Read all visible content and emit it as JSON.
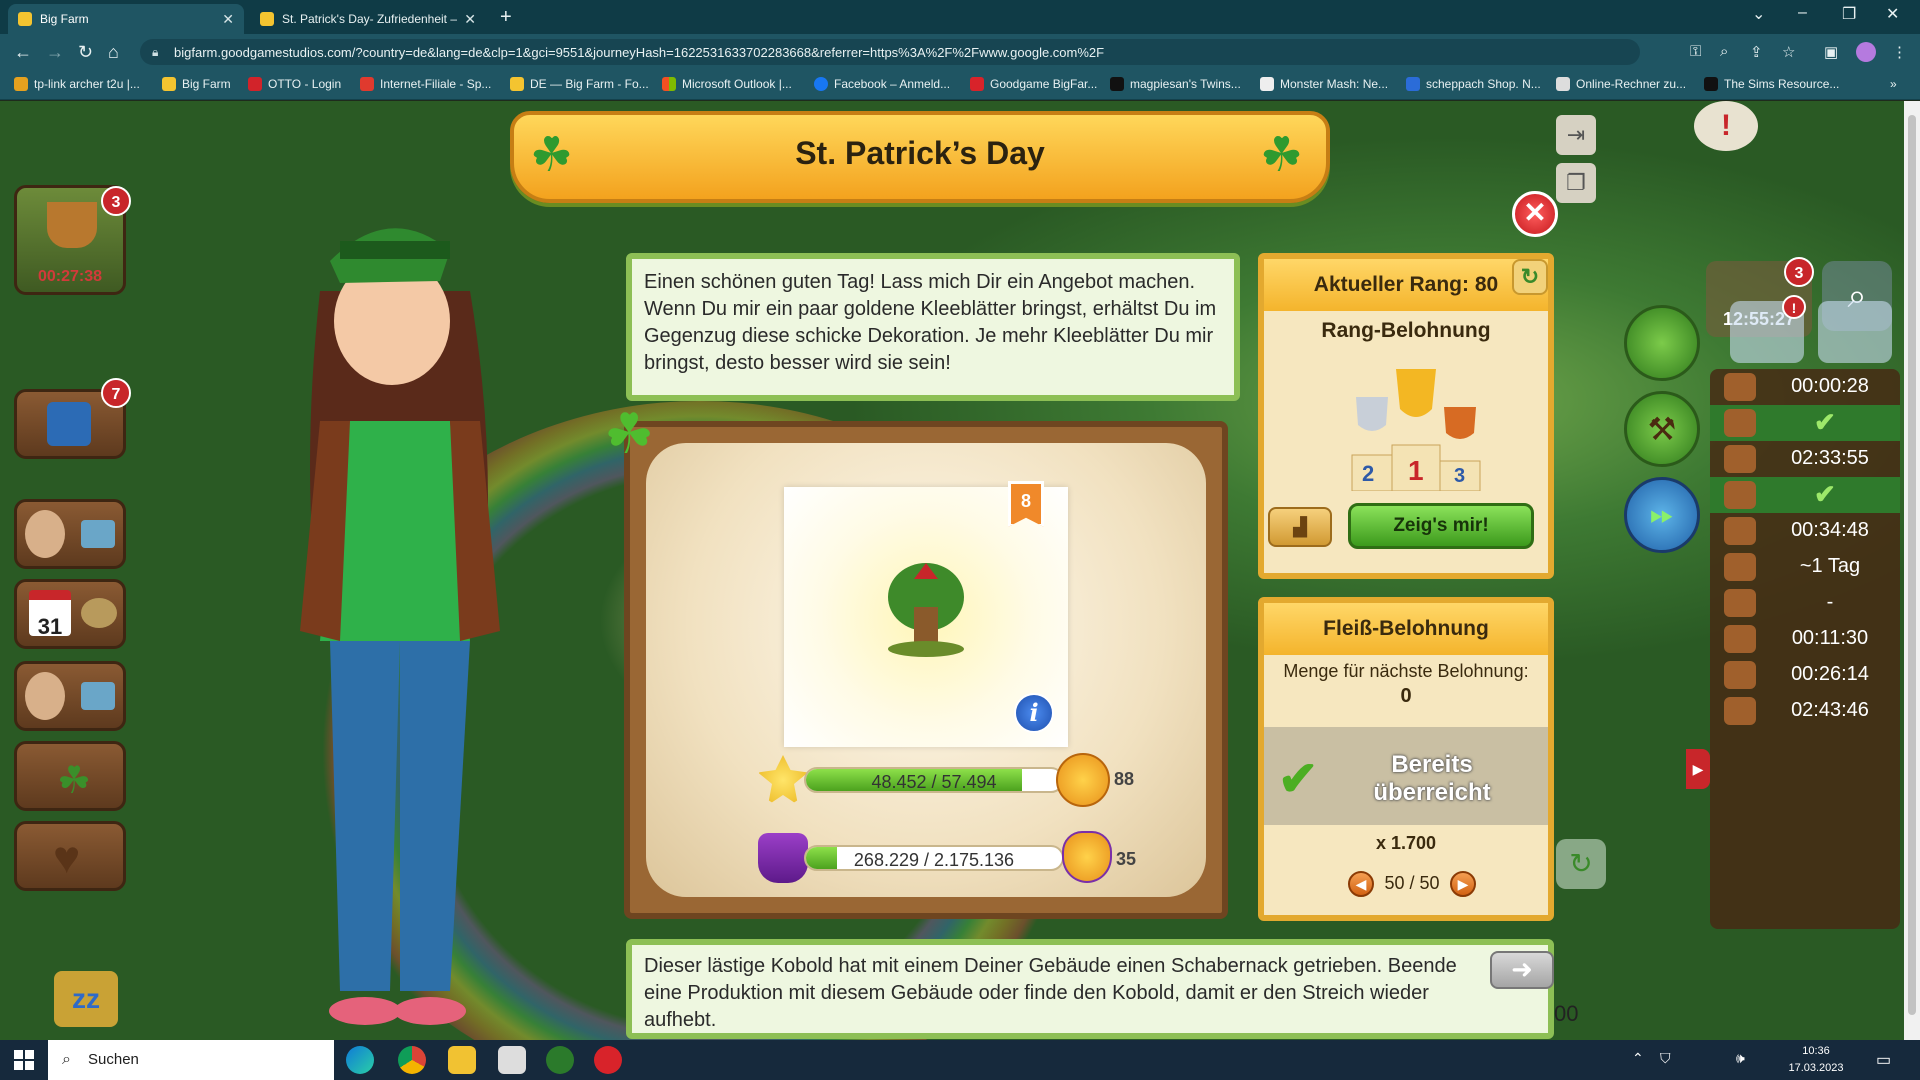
{
  "browser": {
    "tabs": [
      {
        "label": "Big Farm",
        "active": true
      },
      {
        "label": "St. Patrick's Day- Zufriedenheit –",
        "active": false
      }
    ],
    "url": "bigfarm.goodgamestudios.com/?country=de&lang=de&clp=1&gci=9551&journeyHash=1622531633702283668&referrer=https%3A%2F%2Fwww.google.com%2F",
    "bookmarks": [
      "tp-link archer t2u |...",
      "Big Farm",
      "OTTO - Login",
      "Internet-Filiale - Sp...",
      "DE — Big Farm - Fo...",
      "Microsoft Outlook |...",
      "Facebook – Anmeld...",
      "Goodgame BigFar...",
      "magpiesan's Twins...",
      "Monster Mash: Ne...",
      "scheppach Shop. N...",
      "Online-Rechner zu...",
      "The Sims Resource..."
    ]
  },
  "game": {
    "left_panel": {
      "basket_badge": "3",
      "basket_timer": "00:27:38",
      "book_badge": "7",
      "calendar_day": "31"
    },
    "event": {
      "title": "St. Patrick’s Day",
      "speech": "Einen schönen guten Tag! Lass mich Dir ein Angebot machen. Wenn Du mir ein paar goldene Kleeblätter bringst, erhältst Du im Gegenzug diese schicke Dekoration. Je mehr Kleeblätter Du mir bringst, desto besser wird sie sein!",
      "deco_rank": "8",
      "clover_progress": "48.452 / 57.494",
      "clover_fraction": 0.843,
      "clover_count": "88",
      "hat_progress": "268.229 / 2.175.136",
      "hat_fraction": 0.123,
      "hat_count": "35"
    },
    "rank_panel": {
      "title": "Aktueller Rang: 80",
      "subtitle": "Rang-Belohnung",
      "podium": [
        "2",
        "1",
        "3"
      ],
      "show_button": "Zeig's mir!"
    },
    "diligence_panel": {
      "title": "Fleiß-Belohnung",
      "amount_label": "Menge für nächste Belohnung:",
      "amount_value": "0",
      "status": "Bereits überreicht",
      "multiplier": "x 1.700",
      "pager": "50 / 50"
    },
    "hint": "Dieser lästige Kobold hat mit einem Deiner Gebäude einen Schabernack getrieben. Beende eine Produktion mit diesem Gebäude oder finde den Kobold, damit er den Streich wieder aufhebt.",
    "right_top": {
      "badge": "3",
      "timer": "12:55:27"
    },
    "timers": [
      {
        "value": "00:00:28",
        "done": false
      },
      {
        "value": "",
        "done": true
      },
      {
        "value": "02:33:55",
        "done": false
      },
      {
        "value": "",
        "done": true
      },
      {
        "value": "00:34:48",
        "done": false
      },
      {
        "value": "~1 Tag",
        "done": false
      },
      {
        "value": "-",
        "done": false
      },
      {
        "value": "00:11:30",
        "done": false
      },
      {
        "value": "00:26:14",
        "done": false
      },
      {
        "value": "02:43:46",
        "done": false
      }
    ],
    "partial_counter": "00"
  },
  "taskbar": {
    "search_placeholder": "Suchen",
    "time": "10:36",
    "date": "17.03.2023"
  }
}
